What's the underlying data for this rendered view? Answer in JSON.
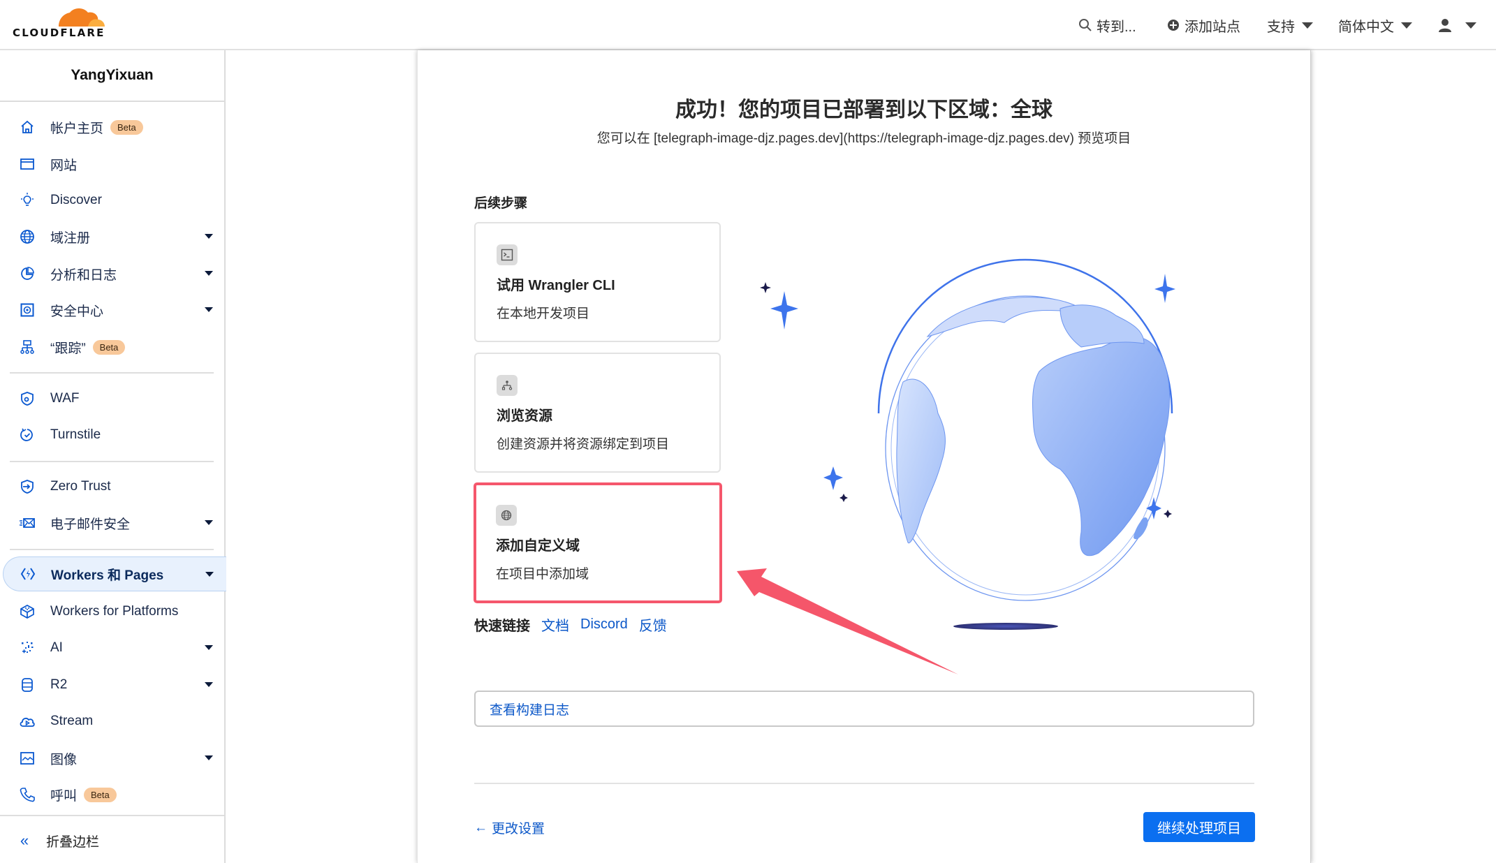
{
  "header": {
    "logo_text": "CLOUDFLARE",
    "goto_label": "转到...",
    "add_site_label": "添加站点",
    "support_label": "支持",
    "language_label": "简体中文",
    "icons": {
      "search": "search-icon",
      "add": "plus-circle-icon",
      "user": "user-icon"
    }
  },
  "sidebar": {
    "account_name": "YangYixuan",
    "items": [
      {
        "label": "帐户主页",
        "icon": "home-icon",
        "badge": "Beta",
        "dropdown": false
      },
      {
        "label": "网站",
        "icon": "browser-window-icon",
        "badge": null,
        "dropdown": false
      },
      {
        "label": "Discover",
        "icon": "lightbulb-icon",
        "badge": null,
        "dropdown": false
      },
      {
        "label": "域注册",
        "icon": "globe-icon",
        "badge": null,
        "dropdown": true
      },
      {
        "label": "分析和日志",
        "icon": "pie-chart-icon",
        "badge": null,
        "dropdown": true
      },
      {
        "label": "安全中心",
        "icon": "safe-icon",
        "badge": null,
        "dropdown": true
      },
      {
        "label": "“跟踪”",
        "icon": "network-tree-icon",
        "badge": "Beta",
        "dropdown": false
      },
      {
        "label": "WAF",
        "icon": "shield-gear-icon",
        "badge": null,
        "dropdown": false
      },
      {
        "label": "Turnstile",
        "icon": "refresh-check-icon",
        "badge": null,
        "dropdown": false
      },
      {
        "label": "Zero Trust",
        "icon": "shield-enter-icon",
        "badge": null,
        "dropdown": false
      },
      {
        "label": "电子邮件安全",
        "icon": "fast-mail-icon",
        "badge": null,
        "dropdown": true
      },
      {
        "label": "Workers 和 Pages",
        "icon": "workers-icon",
        "badge": null,
        "dropdown": true,
        "active": true
      },
      {
        "label": "Workers for Platforms",
        "icon": "cube-icon",
        "badge": null,
        "dropdown": false
      },
      {
        "label": "AI",
        "icon": "sparkle-dots-icon",
        "badge": null,
        "dropdown": true
      },
      {
        "label": "R2",
        "icon": "database-icon",
        "badge": null,
        "dropdown": true
      },
      {
        "label": "Stream",
        "icon": "cloud-play-icon",
        "badge": null,
        "dropdown": false
      },
      {
        "label": "图像",
        "icon": "image-icon",
        "badge": null,
        "dropdown": true
      },
      {
        "label": "呼叫",
        "icon": "phone-icon",
        "badge": "Beta",
        "dropdown": false
      }
    ],
    "collapse_label": "折叠边栏"
  },
  "main": {
    "title": "成功！您的项目已部署到以下区域：全球",
    "subtitle": "您可以在 [telegraph-image-djz.pages.dev](https://telegraph-image-djz.pages.dev) 预览项目",
    "next_steps_heading": "后续步骤",
    "cards": [
      {
        "icon": "terminal-icon",
        "title": "试用 Wrangler CLI",
        "description": "在本地开发项目",
        "highlighted": false
      },
      {
        "icon": "hierarchy-icon",
        "title": "浏览资源",
        "description": "创建资源并将资源绑定到项目",
        "highlighted": false
      },
      {
        "icon": "globe-icon",
        "title": "添加自定义域",
        "description": "在项目中添加域",
        "highlighted": true
      }
    ],
    "quick_links": {
      "label": "快速链接",
      "links": [
        "文档",
        "Discord",
        "反馈"
      ]
    },
    "build_log_label": "查看构建日志",
    "back_label": "更改设置",
    "continue_label": "继续处理项目"
  },
  "colors": {
    "brand_orange": "#f38020",
    "link_blue": "#0b57c8",
    "primary_button": "#0b6ff0",
    "highlight_red": "#f5576c",
    "beta_badge": "#f8c89a",
    "sidebar_active_bg": "#e8f1fd"
  }
}
